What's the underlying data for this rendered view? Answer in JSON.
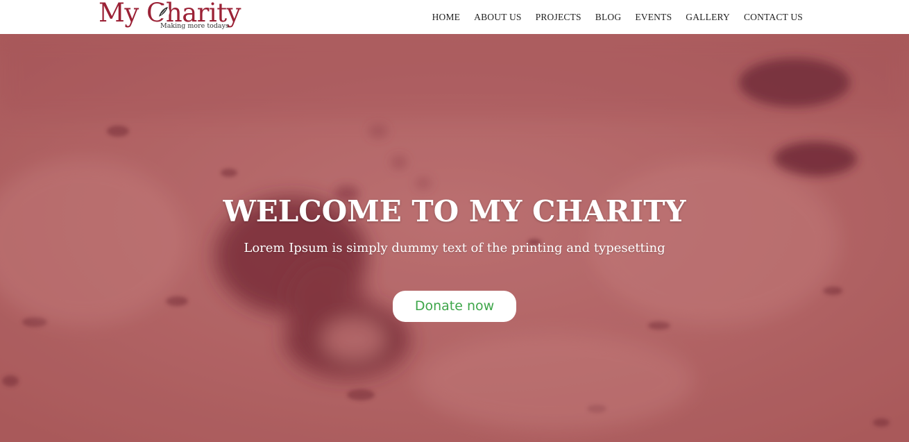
{
  "brand": {
    "name": "My Charity",
    "tagline": "Making more todays",
    "color": "#9b2236"
  },
  "nav": {
    "items": [
      {
        "label": "HOME"
      },
      {
        "label": "ABOUT US"
      },
      {
        "label": "PROJECTS"
      },
      {
        "label": "BLOG"
      },
      {
        "label": "EVENTS"
      },
      {
        "label": "GALLERY"
      },
      {
        "label": "CONTACT US"
      }
    ]
  },
  "hero": {
    "title": "WELCOME TO MY CHARITY",
    "subtitle": "Lorem Ipsum is simply dummy text of the printing and typesetting",
    "donate_label": "Donate now",
    "donate_color": "#3ea64a",
    "background_color": "#b4706f"
  },
  "icons": {
    "logo_leaf": "leaf-icon"
  }
}
